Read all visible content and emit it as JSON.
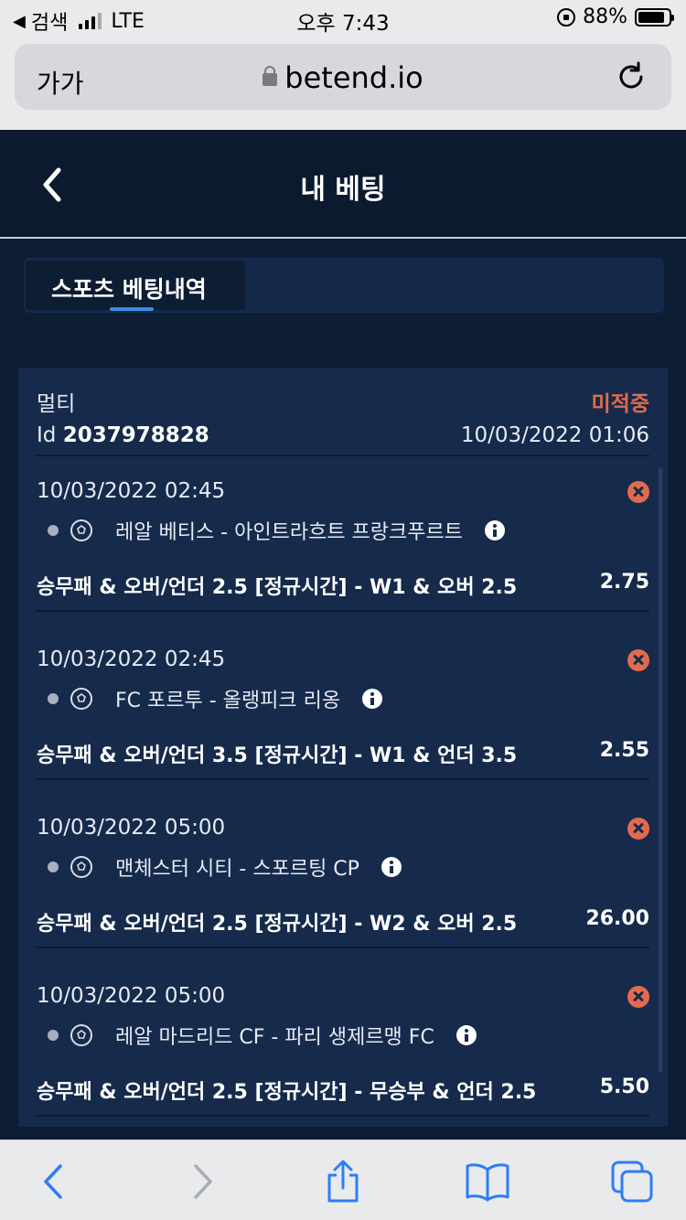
{
  "status_bar": {
    "back_app": "검색",
    "network": "LTE",
    "time": "오후 7:43",
    "battery_pct": "88%",
    "battery_level": 0.88
  },
  "browser": {
    "text_size": "가가",
    "url": "betend.io"
  },
  "header": {
    "title": "내 베팅"
  },
  "tabs": [
    {
      "label": "스포츠 베팅내역",
      "active": true
    }
  ],
  "bet": {
    "type": "멀티",
    "status": "미적중",
    "id_prefix": "Id",
    "id": "2037978828",
    "placed_at": "10/03/2022 01:06",
    "selections": [
      {
        "date": "10/03/2022 02:45",
        "match": "레알 베티스 - 아인트라흐트 프랑크푸르트",
        "market": "승무패 & 오버/언더 2.5 [정규시간] - W1 & 오버 2.5",
        "odds": "2.75"
      },
      {
        "date": "10/03/2022 02:45",
        "match": "FC 포르투 - 올랭피크 리옹",
        "market": "승무패 & 오버/언더 3.5 [정규시간] - W1 & 언더 3.5",
        "odds": "2.55"
      },
      {
        "date": "10/03/2022 05:00",
        "match": "맨체스터 시티 - 스포르팅 CP",
        "market": "승무패 & 오버/언더 2.5 [정규시간] - W2 & 오버 2.5",
        "odds": "26.00"
      },
      {
        "date": "10/03/2022 05:00",
        "match": "레알 마드리드 CF - 파리 생제르맹 FC",
        "market": "승무패 & 오버/언더 2.5 [정규시간] - 무승부 & 언더 2.5",
        "odds": "5.50"
      }
    ]
  },
  "colors": {
    "page_bg": "#0d1d33",
    "card_bg": "#162a4b",
    "lost": "#e06b4f",
    "accent": "#3d8ce0",
    "ios_blue": "#2f7cf6"
  }
}
